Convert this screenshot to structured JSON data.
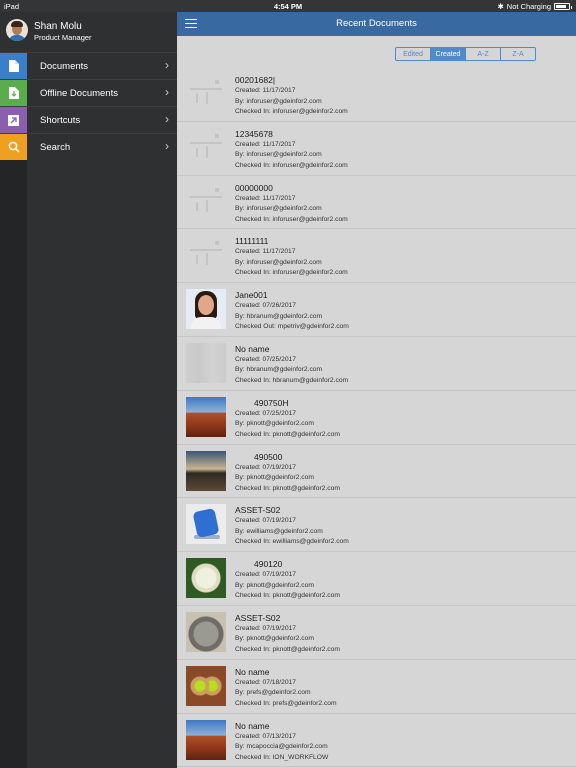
{
  "status_bar": {
    "device": "iPad",
    "time": "4:54 PM",
    "charging": "Not Charging",
    "battery_level": 0.85
  },
  "profile": {
    "name": "Shan Molu",
    "role": "Product Manager"
  },
  "menu": [
    {
      "label": "Documents",
      "icon": "document-icon",
      "color": "#3a7fc9"
    },
    {
      "label": "Offline Documents",
      "icon": "offline-document-icon",
      "color": "#5aad4a"
    },
    {
      "label": "Shortcuts",
      "icon": "shortcut-icon",
      "color": "#8a5fb0"
    },
    {
      "label": "Search",
      "icon": "search-icon",
      "color": "#f0a020"
    }
  ],
  "header": {
    "title": "Recent Documents",
    "menu_icon": "hamburger-icon"
  },
  "sort_tabs": {
    "options": [
      "Edited",
      "Created",
      "A-Z",
      "Z-A"
    ],
    "active": "Created"
  },
  "documents": [
    {
      "name": "00201682|",
      "created": "Created: 11/17/2017",
      "by": "By: inforuser@gdeinfor2.com",
      "status": "Checked In: inforuser@gdeinfor2.com",
      "thumb": "blank"
    },
    {
      "name": "12345678",
      "created": "Created: 11/17/2017",
      "by": "By: inforuser@gdeinfor2.com",
      "status": "Checked In: inforuser@gdeinfor2.com",
      "thumb": "blank"
    },
    {
      "name": "00000000",
      "created": "Created: 11/17/2017",
      "by": "By: inforuser@gdeinfor2.com",
      "status": "Checked In: inforuser@gdeinfor2.com",
      "thumb": "blank"
    },
    {
      "name": "11111111",
      "created": "Created: 11/17/2017",
      "by": "By: inforuser@gdeinfor2.com",
      "status": "Checked In: inforuser@gdeinfor2.com",
      "thumb": "blank"
    },
    {
      "name": "Jane001",
      "created": "Created: 07/26/2017",
      "by": "By: hbranum@gdeinfor2.com",
      "status": "Checked Out: mpetriv@gdeinfor2.com",
      "thumb": "face"
    },
    {
      "name": "No name",
      "created": "Created: 07/25/2017",
      "by": "By: hbranum@gdeinfor2.com",
      "status": "Checked In: hbranum@gdeinfor2.com",
      "thumb": "grey"
    },
    {
      "name": "490750H",
      "created": "Created: 07/25/2017",
      "by": "By: pknott@gdeinfor2.com",
      "status": "Checked In: pknott@gdeinfor2.com",
      "thumb": "red",
      "indent": true
    },
    {
      "name": "490500",
      "created": "Created: 07/19/2017",
      "by": "By: pknott@gdeinfor2.com",
      "status": "Checked In: pknott@gdeinfor2.com",
      "thumb": "sunset",
      "indent": true
    },
    {
      "name": "ASSET-S02",
      "created": "Created: 07/19/2017",
      "by": "By: ewilliams@gdeinfor2.com",
      "status": "Checked In: ewilliams@gdeinfor2.com",
      "thumb": "blue"
    },
    {
      "name": "490120",
      "created": "Created: 07/19/2017",
      "by": "By: pknott@gdeinfor2.com",
      "status": "Checked In: pknott@gdeinfor2.com",
      "thumb": "flower",
      "indent": true
    },
    {
      "name": "ASSET-S02",
      "created": "Created: 07/19/2017",
      "by": "By: pknott@gdeinfor2.com",
      "status": "Checked In: pknott@gdeinfor2.com",
      "thumb": "koala"
    },
    {
      "name": "No name",
      "created": "Created: 07/18/2017",
      "by": "By: prefs@gdeinfor2.com",
      "status": "Checked In: prefs@gdeinfor2.com",
      "thumb": "frog"
    },
    {
      "name": "No name",
      "created": "Created: 07/13/2017",
      "by": "By: mcapoccia@gdeinfor2.com",
      "status": "Checked In: ION_WORKFLOW",
      "thumb": "red"
    }
  ]
}
